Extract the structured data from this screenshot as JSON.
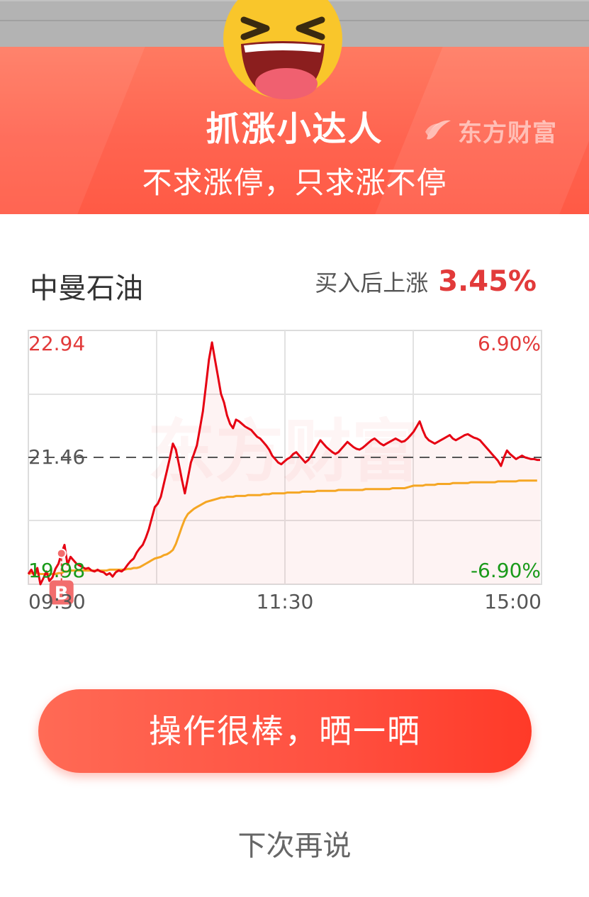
{
  "header": {
    "brand": "东方财富",
    "title": "抓涨小达人",
    "subtitle": "不求涨停，只求涨不停"
  },
  "stock": {
    "name": "中曼石油",
    "gain_label": "买入后上涨",
    "gain_value": "3.45%"
  },
  "chart_data": {
    "type": "line",
    "price_high": "22.94",
    "price_mid": "21.46",
    "price_low": "19.98",
    "pct_high": "6.90%",
    "pct_low": "-6.90%",
    "time_labels": [
      "09:30",
      "11:30",
      "15:00"
    ],
    "watermark": "东方财富",
    "buy_marker": "B",
    "ylim": [
      19.98,
      22.94
    ],
    "reference_price": 21.46,
    "colors": {
      "price": "#e60012",
      "avg": "#f5a623",
      "up": "#e23a3a",
      "down": "#1a9a1a"
    },
    "series": [
      {
        "values": [
          20.1,
          20.15,
          20.08,
          20.17,
          19.98,
          20.05,
          20.13,
          20.02,
          20.06,
          20.16,
          20.22,
          20.34,
          20.44,
          20.21,
          20.3,
          20.26,
          20.22,
          20.2,
          20.18,
          20.16,
          20.17,
          20.14,
          20.13,
          20.15,
          20.13,
          20.12,
          20.09,
          20.11,
          20.07,
          20.12,
          20.14,
          20.13,
          20.16,
          20.21,
          20.25,
          20.28,
          20.35,
          20.4,
          20.44,
          20.52,
          20.62,
          20.75,
          20.88,
          20.92,
          21.0,
          21.15,
          21.3,
          21.45,
          21.62,
          21.55,
          21.38,
          21.2,
          21.04,
          21.22,
          21.4,
          21.5,
          21.6,
          21.8,
          22.0,
          22.3,
          22.6,
          22.8,
          22.6,
          22.4,
          22.2,
          22.1,
          21.95,
          21.85,
          21.8,
          21.9,
          21.88,
          21.85,
          21.82,
          21.8,
          21.78,
          21.74,
          21.7,
          21.68,
          21.64,
          21.6,
          21.55,
          21.48,
          21.44,
          21.4,
          21.38,
          21.41,
          21.44,
          21.46,
          21.5,
          21.52,
          21.48,
          21.44,
          21.4,
          21.43,
          21.48,
          21.54,
          21.6,
          21.66,
          21.62,
          21.58,
          21.55,
          21.52,
          21.5,
          21.52,
          21.56,
          21.6,
          21.64,
          21.61,
          21.58,
          21.56,
          21.55,
          21.57,
          21.6,
          21.63,
          21.66,
          21.68,
          21.65,
          21.62,
          21.6,
          21.62,
          21.64,
          21.66,
          21.68,
          21.66,
          21.64,
          21.65,
          21.68,
          21.72,
          21.76,
          21.82,
          21.88,
          21.78,
          21.7,
          21.66,
          21.64,
          21.62,
          21.64,
          21.66,
          21.68,
          21.7,
          21.72,
          21.68,
          21.66,
          21.68,
          21.7,
          21.72,
          21.73,
          21.71,
          21.69,
          21.68,
          21.66,
          21.62,
          21.58,
          21.54,
          21.5,
          21.46,
          21.42,
          21.36,
          21.46,
          21.54,
          21.5,
          21.47,
          21.44,
          21.46,
          21.48,
          21.46,
          21.45,
          21.44,
          21.44,
          21.43,
          21.43
        ]
      },
      {
        "values": [
          20.1,
          20.11,
          20.11,
          20.11,
          20.1,
          20.1,
          20.1,
          20.1,
          20.1,
          20.1,
          20.11,
          20.11,
          20.13,
          20.13,
          20.14,
          20.14,
          20.14,
          20.14,
          20.14,
          20.14,
          20.14,
          20.14,
          20.14,
          20.14,
          20.14,
          20.14,
          20.14,
          20.15,
          20.15,
          20.15,
          20.15,
          20.15,
          20.15,
          20.16,
          20.16,
          20.17,
          20.17,
          20.18,
          20.2,
          20.22,
          20.24,
          20.26,
          20.28,
          20.29,
          20.3,
          20.32,
          20.33,
          20.35,
          20.38,
          20.45,
          20.55,
          20.65,
          20.74,
          20.8,
          20.83,
          20.86,
          20.88,
          20.9,
          20.92,
          20.94,
          20.95,
          20.96,
          20.97,
          20.98,
          20.99,
          20.99,
          21.0,
          21.0,
          21.0,
          21.01,
          21.01,
          21.01,
          21.01,
          21.02,
          21.02,
          21.02,
          21.02,
          21.02,
          21.03,
          21.03,
          21.03,
          21.04,
          21.04,
          21.04,
          21.04,
          21.04,
          21.05,
          21.05,
          21.05,
          21.05,
          21.05,
          21.06,
          21.06,
          21.06,
          21.06,
          21.06,
          21.07,
          21.07,
          21.07,
          21.07,
          21.07,
          21.07,
          21.07,
          21.08,
          21.08,
          21.08,
          21.08,
          21.08,
          21.08,
          21.08,
          21.08,
          21.08,
          21.09,
          21.09,
          21.09,
          21.09,
          21.09,
          21.09,
          21.09,
          21.09,
          21.09,
          21.1,
          21.1,
          21.1,
          21.1,
          21.1,
          21.11,
          21.12,
          21.13,
          21.13,
          21.13,
          21.13,
          21.14,
          21.14,
          21.14,
          21.14,
          21.15,
          21.15,
          21.15,
          21.15,
          21.15,
          21.16,
          21.16,
          21.16,
          21.16,
          21.16,
          21.16,
          21.17,
          21.17,
          21.17,
          21.17,
          21.17,
          21.17,
          21.17,
          21.17,
          21.17,
          21.18,
          21.18,
          21.18,
          21.18,
          21.18,
          21.18,
          21.18,
          21.19,
          21.19,
          21.19,
          21.19,
          21.19,
          21.19,
          21.19
        ]
      }
    ],
    "buy_point_index": 11,
    "buy_price": 20.34
  },
  "actions": {
    "share_label": "操作很棒，晒一晒",
    "later_label": "下次再说"
  }
}
